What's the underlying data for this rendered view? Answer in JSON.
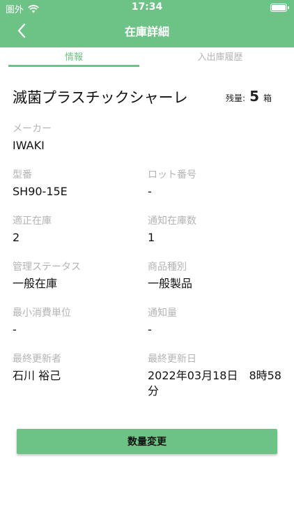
{
  "status": {
    "carrier": "圏外",
    "time": "17:34"
  },
  "nav": {
    "title": "在庫詳細"
  },
  "tabs": [
    {
      "label": "情報",
      "active": true
    },
    {
      "label": "入出庫履歴",
      "active": false
    }
  ],
  "product": {
    "name": "滅菌プラスチックシャーレ",
    "stock_label": "残量:",
    "stock_value": "5",
    "stock_unit": "箱"
  },
  "fields": {
    "maker": {
      "label": "メーカー",
      "value": "IWAKI"
    },
    "model": {
      "label": "型番",
      "value": "SH90-15E"
    },
    "lot": {
      "label": "ロット番号",
      "value": "-"
    },
    "proper_stock": {
      "label": "適正在庫",
      "value": "2"
    },
    "notify_stock": {
      "label": "通知在庫数",
      "value": "1"
    },
    "manage_status": {
      "label": "管理ステータス",
      "value": "一般在庫"
    },
    "product_type": {
      "label": "商品種別",
      "value": "一般製品"
    },
    "min_unit": {
      "label": "最小消費単位",
      "value": "-"
    },
    "notify_amount": {
      "label": "通知量",
      "value": "-"
    },
    "updater": {
      "label": "最終更新者",
      "value": "石川 裕己"
    },
    "updated_at": {
      "label": "最終更新日",
      "value": "2022年03月18日　8時58分"
    }
  },
  "action": {
    "label": "数量変更"
  },
  "colors": {
    "accent": "#6cc385",
    "label_gray": "#b4b4b4"
  }
}
